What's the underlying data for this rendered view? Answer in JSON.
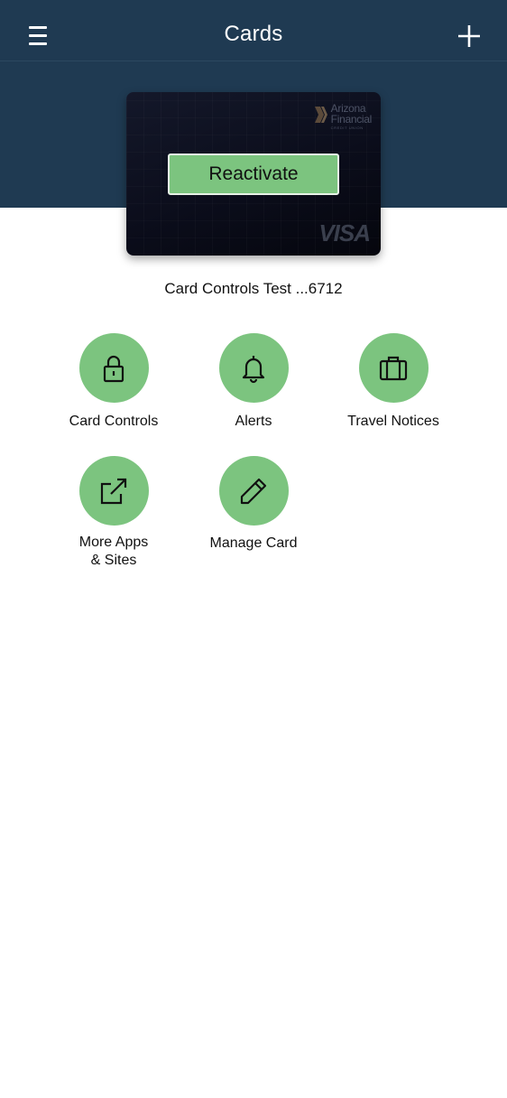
{
  "navbar": {
    "title": "Cards",
    "menu_icon": "hamburger-menu-icon",
    "add_icon": "plus-icon"
  },
  "card": {
    "issuer_name_line1": "Arizona",
    "issuer_name_line2": "Financial",
    "issuer_sub": "CREDIT UNION",
    "reactivate_label": "Reactivate",
    "network": "VISA",
    "name": "Card Controls Test ...6712"
  },
  "actions": [
    {
      "label": "Card Controls",
      "icon": "lock-icon"
    },
    {
      "label": "Alerts",
      "icon": "bell-icon"
    },
    {
      "label": "Travel Notices",
      "icon": "suitcase-icon"
    },
    {
      "label": "More Apps",
      "label_line2": "& Sites",
      "icon": "external-link-icon"
    },
    {
      "label": "Manage Card",
      "icon": "pencil-icon"
    }
  ],
  "colors": {
    "header": "#1f3a52",
    "accent_green": "#7cc47f",
    "card_dark": "#0b0d1b"
  }
}
